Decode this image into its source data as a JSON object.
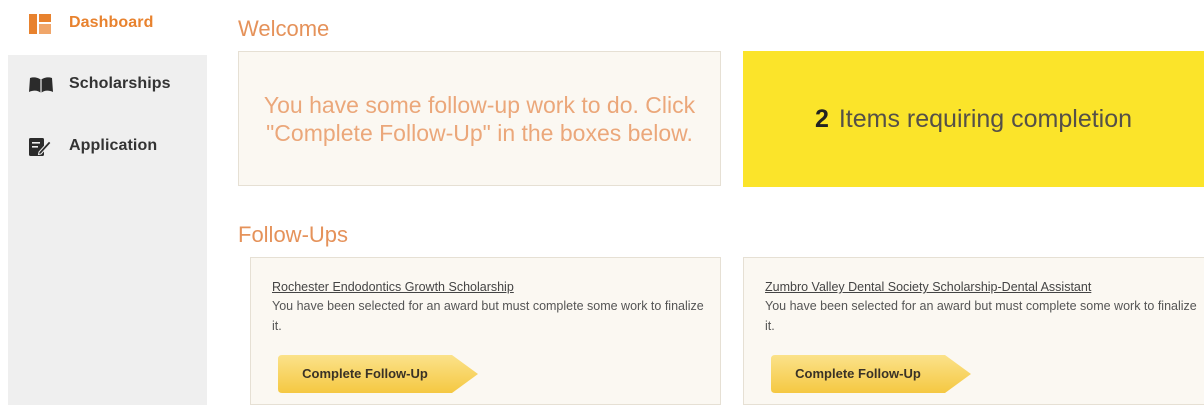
{
  "sidebar": {
    "items": [
      {
        "label": "Dashboard",
        "icon": "dashboard-icon",
        "active": true
      },
      {
        "label": "Scholarships",
        "icon": "book-icon",
        "active": false
      },
      {
        "label": "Application",
        "icon": "edit-document-icon",
        "active": false
      }
    ]
  },
  "main": {
    "welcome_heading": "Welcome",
    "welcome_message": "You have some follow-up work to do. Click \"Complete Follow-Up\" in the boxes below.",
    "completion": {
      "count": "2",
      "text": "Items requiring completion"
    },
    "followups_heading": "Follow-Ups",
    "cards": [
      {
        "title": "Rochester Endodontics Growth Scholarship",
        "description": "You have been selected for an award but must complete some work to finalize it.",
        "button": "Complete Follow-Up"
      },
      {
        "title": "Zumbro Valley Dental Society Scholarship-Dental Assistant",
        "description": "You have been selected for an award but must complete some work to finalize it.",
        "button": "Complete Follow-Up"
      }
    ]
  },
  "colors": {
    "accent_orange": "#e8822e",
    "heading": "#e5925a",
    "highlight_yellow": "#fbe42a",
    "button_yellow": "#f8d45a",
    "sidebar_bg": "#efefef"
  }
}
